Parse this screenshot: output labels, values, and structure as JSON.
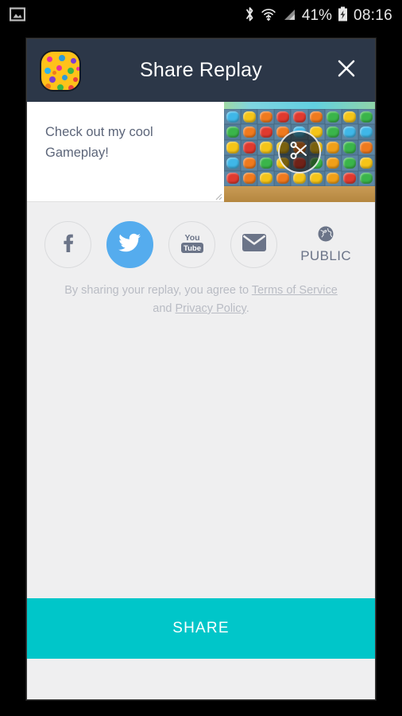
{
  "statusbar": {
    "notification_icon": "screenshot-image-icon",
    "bluetooth_icon": "bluetooth-icon",
    "wifi_icon": "wifi-icon",
    "signal_icon": "cellular-signal-icon",
    "battery_percent": "41%",
    "battery_icon": "battery-charging-icon",
    "clock": "08:16"
  },
  "header": {
    "title": "Share Replay",
    "app_icon": "candy-app-icon",
    "close_icon": "close-icon",
    "background_color": "#2c3748"
  },
  "compose": {
    "message_value": "Check out my cool Gameplay!",
    "message_placeholder": "Check out my cool Gameplay!",
    "preview_alt": "gameplay-video-thumbnail",
    "trim_icon": "scissors-icon"
  },
  "socials": [
    {
      "name": "facebook",
      "icon": "facebook-icon",
      "label": "Facebook",
      "selected": false
    },
    {
      "name": "twitter",
      "icon": "twitter-icon",
      "label": "Twitter",
      "selected": true
    },
    {
      "name": "youtube",
      "icon": "youtube-icon",
      "label": "YouTube",
      "selected": false
    },
    {
      "name": "email",
      "icon": "envelope-icon",
      "label": "Email",
      "selected": false
    }
  ],
  "privacy": {
    "icon": "globe-icon",
    "label": "PUBLIC"
  },
  "terms": {
    "prefix": "By sharing your replay, you agree to ",
    "tos_link": "Terms of Service",
    "middle": " and ",
    "privacy_link": "Privacy Policy",
    "suffix": "."
  },
  "share": {
    "label": "SHARE",
    "color": "#00c6c9"
  },
  "colors": {
    "twitter_blue": "#55acee",
    "header_navy": "#2c3748",
    "body_gray": "#efeff0",
    "text_slate": "#5c6579",
    "muted": "#b9bcc4"
  }
}
